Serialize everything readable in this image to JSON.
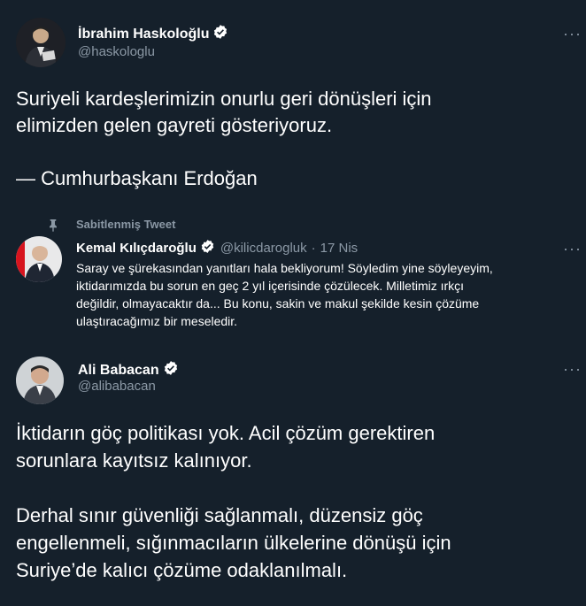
{
  "colors": {
    "background": "#15202b",
    "text_primary": "#ffffff",
    "text_secondary": "#8b98a5",
    "verified_badge": "#ffffff"
  },
  "tweets": [
    {
      "name": "İbrahim Haskoloğlu",
      "handle": "@haskologlu",
      "verified": true,
      "more_icon": "more-horizontal-icon",
      "text": "Suriyeli kardeşlerimizin onurlu geri dönüşleri için\nelimizden gelen gayreti gösteriyoruz.\n\n— Cumhurbaşkanı Erdoğan"
    },
    {
      "pinned_label": "Sabitlenmiş Tweet",
      "pin_icon": "pin-icon",
      "name": "Kemal Kılıçdaroğlu",
      "handle": "@kilicdarogluk",
      "separator": "·",
      "date": "17 Nis",
      "verified": true,
      "more_icon": "more-horizontal-icon",
      "text": "Saray ve şürekasından yanıtları hala bekliyorum! Söyledim yine söyleyeyim,\niktidarımızda bu sorun en geç 2 yıl içerisinde çözülecek. Milletimiz ırkçı\ndeğildir, olmayacaktır da... Bu konu, sakin ve makul şekilde kesin çözüme\nulaştıracağımız bir meseledir."
    },
    {
      "name": "Ali Babacan",
      "handle": "@alibabacan",
      "verified": true,
      "more_icon": "more-horizontal-icon",
      "text": "İktidarın göç politikası yok. Acil çözüm gerektiren\nsorunlara kayıtsız kalınıyor.\n\nDerhal sınır güvenliği sağlanmalı, düzensiz göç\nengellenmeli, sığınmacıların ülkelerine dönüşü için\nSuriye’de kalıcı çözüme odaklanılmalı."
    }
  ]
}
